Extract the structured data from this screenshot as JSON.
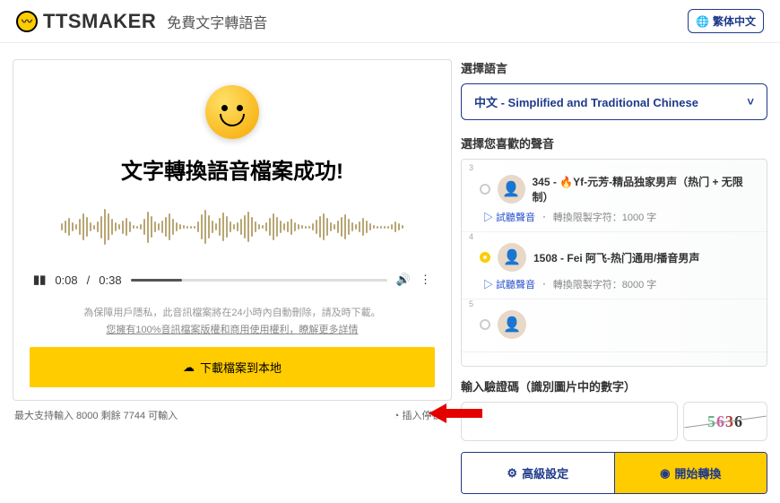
{
  "header": {
    "brand": "TTSMAKER",
    "subtitle": "免費文字轉語音",
    "lang_btn": "繁体中文"
  },
  "result": {
    "success_title": "文字轉換語音檔案成功!",
    "time_current": "0:08",
    "time_total": "0:38",
    "privacy": "為保障用戶隱私，此音訊檔案將在24小時內自動刪除，請及時下載。",
    "rights": "您擁有100%音訊檔案版權和商用使用權利，瞭解更多詳情",
    "download": "下載檔案到本地"
  },
  "footer": {
    "quota": "最大支持輸入 8000 剩餘 7744 可輸入",
    "insert_pause": "插入停頓"
  },
  "language": {
    "label": "選擇語言",
    "selected": "中文 - Simplified and Traditional Chinese"
  },
  "voices": {
    "label": "選擇您喜歡的聲音",
    "items": [
      {
        "num": "3",
        "name": "345 - 🔥Yf-元芳-精品独家男声（热门 + 无限制）",
        "try": "試聽聲音",
        "limit": "轉換限製字符：1000 字",
        "checked": false
      },
      {
        "num": "4",
        "name": "1508 - Fei 阿飞-热门通用/播音男声",
        "try": "試聽聲音",
        "limit": "轉換限製字符：8000 字",
        "checked": true
      },
      {
        "num": "5",
        "name": "",
        "try": "",
        "limit": "",
        "checked": false
      }
    ]
  },
  "captcha": {
    "label": "輸入驗證碼（識別圖片中的數字）",
    "code": [
      "5",
      "6",
      "3",
      "6"
    ]
  },
  "actions": {
    "advanced": "高級設定",
    "convert": "開始轉換"
  }
}
